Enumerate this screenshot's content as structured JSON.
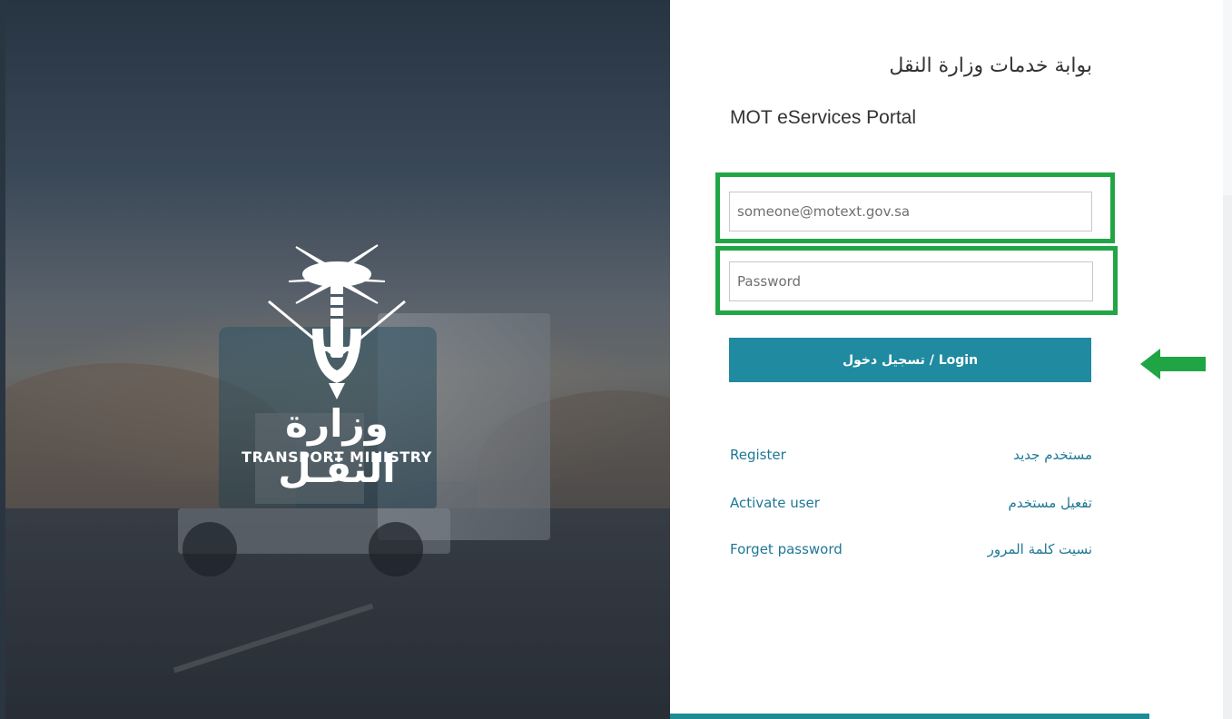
{
  "brand": {
    "logo_ar": "وزارة النقـل",
    "logo_en": "TRANSPORT MINISTRY"
  },
  "header": {
    "title_ar": "بوابة خدمات وزارة النقل",
    "title_en": "MOT eServices Portal"
  },
  "form": {
    "email_placeholder": "someone@motext.gov.sa",
    "email_value": "",
    "password_placeholder": "Password",
    "password_value": "",
    "login_label": "تسجيل دخول / Login"
  },
  "links": [
    {
      "en": "Register",
      "ar": "مستخدم جديد"
    },
    {
      "en": "Activate user",
      "ar": "تفعيل مستخدم"
    },
    {
      "en": "Forget password",
      "ar": "نسيت كلمة المرور"
    }
  ],
  "colors": {
    "primary": "#1f8aa0",
    "link": "#1e7896",
    "highlight": "#22a645",
    "annotation_arrow": "#20a545"
  },
  "icons": {
    "logo": "palm-tree-emblem-icon",
    "arrow": "left-arrow-icon"
  }
}
